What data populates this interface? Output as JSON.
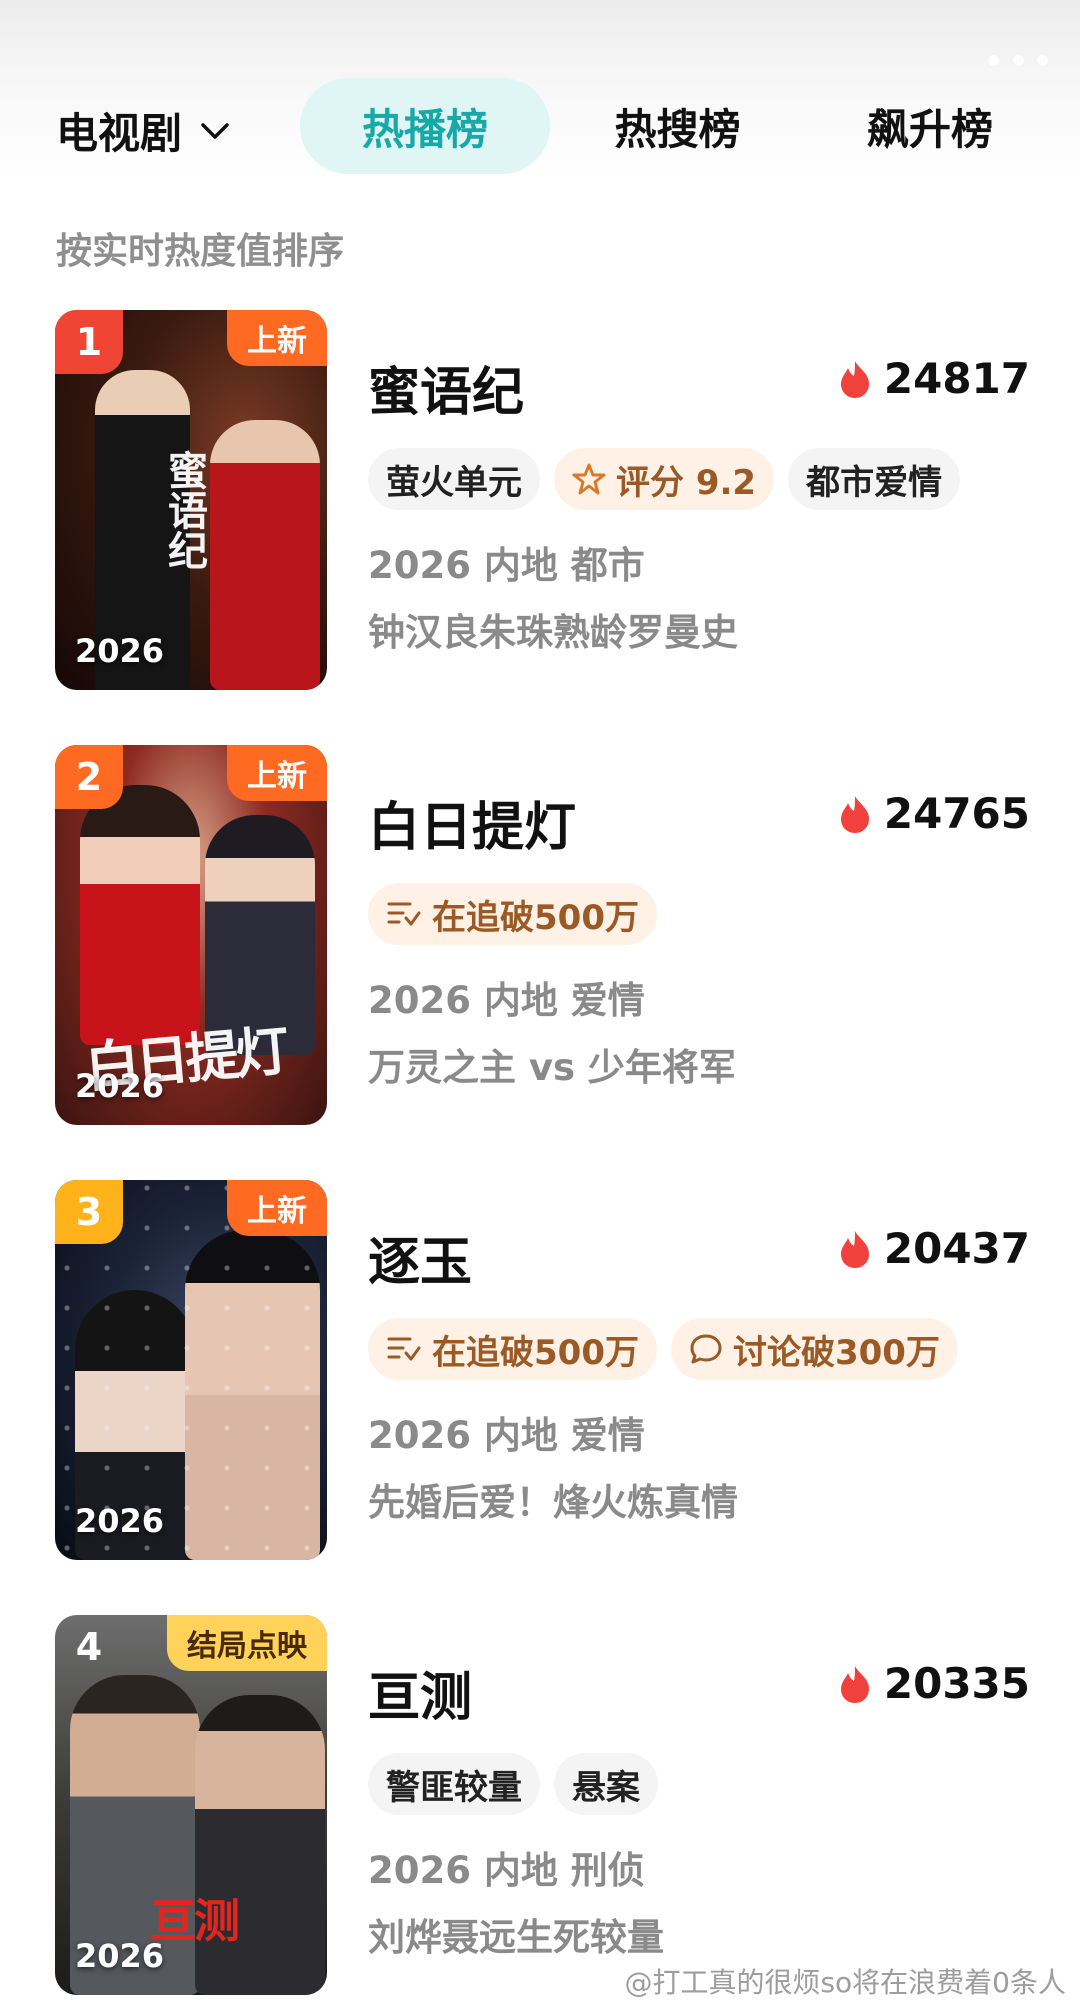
{
  "header": {
    "category": "电视剧",
    "tabs": [
      {
        "label": "热播榜",
        "active": true
      },
      {
        "label": "热搜榜",
        "active": false
      },
      {
        "label": "飙升榜",
        "active": false
      }
    ]
  },
  "subtitle": "按实时热度值排序",
  "items": [
    {
      "rank": "1",
      "rank_color": "#f04435",
      "badge": "上新",
      "poster_year": "2026",
      "poster_art": "蜜语纪",
      "title": "蜜语纪",
      "heat": "24817",
      "tags": [
        "萤火单元",
        "评分 9.2",
        "都市爱情"
      ],
      "meta": "2026 内地 都市",
      "desc": "钟汉良朱珠熟龄罗曼史"
    },
    {
      "rank": "2",
      "rank_color": "#ff6a22",
      "badge": "上新",
      "poster_year": "2026",
      "poster_art": "白日提灯",
      "title": "白日提灯",
      "heat": "24765",
      "tags": [
        "在追破500万"
      ],
      "meta": "2026 内地 爱情",
      "desc": "万灵之主 vs 少年将军"
    },
    {
      "rank": "3",
      "rank_color": "#ffb21a",
      "badge": "上新",
      "poster_year": "2026",
      "title": "逐玉",
      "heat": "20437",
      "tags": [
        "在追破500万",
        "讨论破300万"
      ],
      "meta": "2026 内地 爱情",
      "desc": "先婚后爱！烽火炼真情"
    },
    {
      "rank": "4",
      "badge": "结局点映",
      "poster_year": "2026",
      "poster_art": "亘测",
      "title": "亘测",
      "heat": "20335",
      "tags": [
        "警匪较量",
        "悬案"
      ],
      "meta": "2026 内地 刑侦",
      "desc": "刘烨聂远生死较量"
    }
  ],
  "watermark": "@打工真的很烦so将在浪费着0条人",
  "colors": {
    "accent": "#16a9a7",
    "accent_bg": "#dff6f4",
    "fire": "#f0413c",
    "tag_orange_bg": "#fff1e5"
  }
}
